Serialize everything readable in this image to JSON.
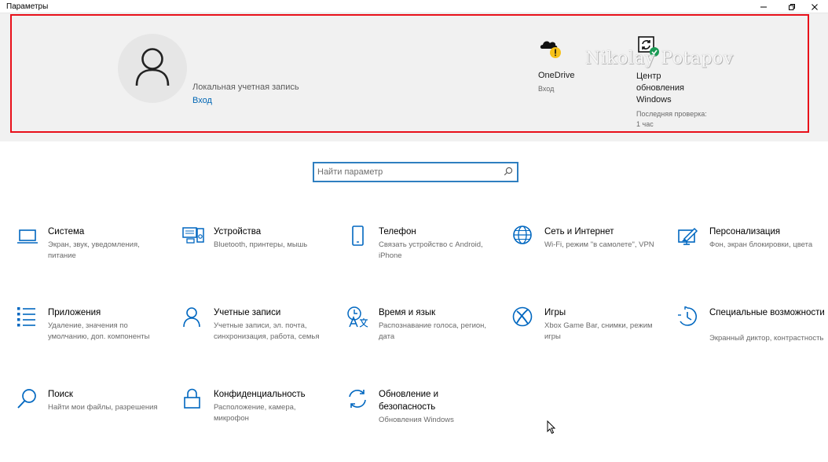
{
  "window": {
    "title": "Параметры"
  },
  "header": {
    "account_type": "Локальная учетная запись",
    "signin_link": "Вход",
    "onedrive": {
      "label": "OneDrive",
      "status": "Вход"
    },
    "update": {
      "label": "Центр обновления Windows",
      "status": "Последняя проверка: 1 час"
    },
    "watermark": "Nikolay Potapov"
  },
  "search": {
    "placeholder": "Найти параметр",
    "value": ""
  },
  "categories": [
    {
      "name": "Система",
      "desc": "Экран, звук, уведомления, питание",
      "icon": "laptop-icon"
    },
    {
      "name": "Устройства",
      "desc": "Bluetooth, принтеры, мышь",
      "icon": "devices-icon"
    },
    {
      "name": "Телефон",
      "desc": "Связать устройство с Android, iPhone",
      "icon": "phone-icon"
    },
    {
      "name": "Сеть и Интернет",
      "desc": "Wi-Fi, режим \"в самолете\", VPN",
      "icon": "globe-icon"
    },
    {
      "name": "Персонализация",
      "desc": "Фон, экран блокировки, цвета",
      "icon": "personalization-icon"
    },
    {
      "name": "Приложения",
      "desc": "Удаление, значения по умолчанию, доп. компоненты",
      "icon": "apps-list-icon"
    },
    {
      "name": "Учетные записи",
      "desc": "Учетные записи, эл. почта, синхронизация, работа, семья",
      "icon": "person-icon"
    },
    {
      "name": "Время и язык",
      "desc": "Распознавание голоса, регион, дата",
      "icon": "time-language-icon"
    },
    {
      "name": "Игры",
      "desc": "Xbox Game Bar, снимки, режим игры",
      "icon": "xbox-icon"
    },
    {
      "name": "Специальные возможности",
      "desc": "Экранный диктор, контрастность",
      "icon": "accessibility-icon"
    },
    {
      "name": "Поиск",
      "desc": "Найти мои файлы, разрешения",
      "icon": "search-icon"
    },
    {
      "name": "Конфиденциальность",
      "desc": "Расположение, камера, микрофон",
      "icon": "lock-icon"
    },
    {
      "name": "Обновление и безопасность",
      "desc": "Обновления Windows",
      "icon": "sync-icon"
    }
  ],
  "colors": {
    "accent": "#0067c0",
    "highlight_border": "#e8101a",
    "header_bg": "#f1f1f1"
  }
}
